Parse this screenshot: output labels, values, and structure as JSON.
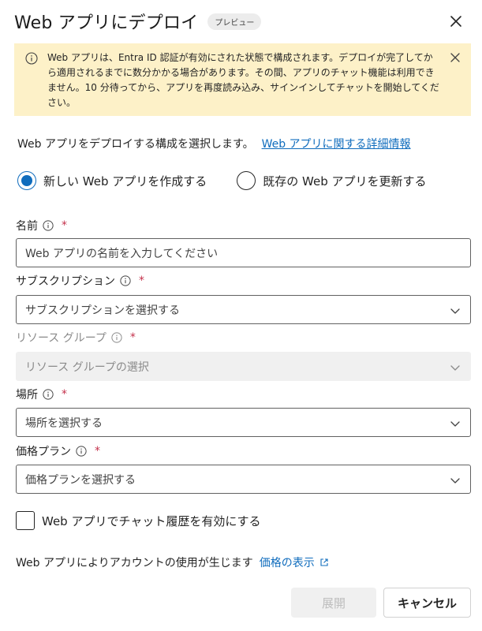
{
  "dialog": {
    "title": "Web アプリにデプロイ",
    "badge": "プレビュー"
  },
  "banner": {
    "text": "Web アプリは、Entra ID 認証が有効にされた状態で構成されます。デプロイが完了してから適用されるまでに数分かかる場合があります。その間、アプリのチャット機能は利用できません。10 分待ってから、アプリを再度読み込み、サインインしてチャットを開始してください。"
  },
  "intro": {
    "text": "Web アプリをデプロイする構成を選択します。",
    "link": "Web アプリに関する詳細情報"
  },
  "options": {
    "create_new": "新しい Web アプリを作成する",
    "update_existing": "既存の Web アプリを更新する",
    "selected": "create_new"
  },
  "fields": {
    "name": {
      "label": "名前",
      "required": "*",
      "placeholder": "Web アプリの名前を入力してください",
      "value": ""
    },
    "subscription": {
      "label": "サブスクリプション",
      "required": "*",
      "placeholder": "サブスクリプションを選択する"
    },
    "resource_group": {
      "label": "リソース グループ",
      "required": "*",
      "placeholder": "リソース グループの選択"
    },
    "location": {
      "label": "場所",
      "required": "*",
      "placeholder": "場所を選択する"
    },
    "pricing_plan": {
      "label": "価格プラン",
      "required": "*",
      "placeholder": "価格プランを選択する"
    }
  },
  "chat_history": {
    "label": "Web アプリでチャット履歴を有効にする",
    "checked": false
  },
  "pricing": {
    "text": "Web アプリによりアカウントの使用が生じます",
    "link": "価格の表示"
  },
  "buttons": {
    "deploy": "展開",
    "cancel": "キャンセル"
  },
  "colors": {
    "accent": "#0f6cbd",
    "banner_bg": "#fdf1c8",
    "required": "#c4314b"
  }
}
